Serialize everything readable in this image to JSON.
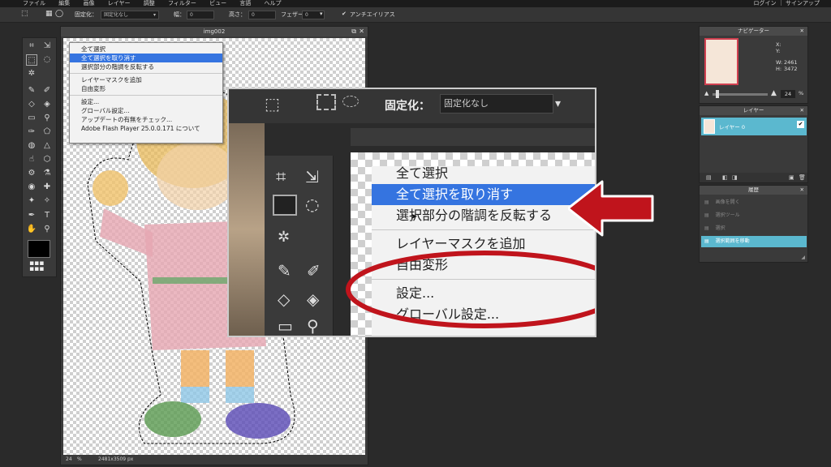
{
  "menubar": {
    "items": [
      "ファイル",
      "編集",
      "画像",
      "レイヤー",
      "調整",
      "フィルター",
      "ビュー",
      "言語",
      "ヘルプ"
    ],
    "right": "ログイン ｜ サインアップ"
  },
  "options": {
    "fixed_label": "固定化：",
    "fixed_value": "固定化なし",
    "width_label": "幅：",
    "width_value": "0",
    "height_label": "高さ：",
    "height_value": "0",
    "feather_label": "フェザー：",
    "feather_value": "0",
    "antialias_label": "アンチエイリアス"
  },
  "document": {
    "title": "img002",
    "zoom": "24",
    "zoom_unit": "%",
    "size": "2481x3509 px"
  },
  "context_menu": {
    "items": [
      {
        "label": "全て選択",
        "highlighted": false
      },
      {
        "label": "全て選択を取り消す",
        "highlighted": true
      },
      {
        "label": "選択部分の階調を反転する",
        "highlighted": false
      },
      {
        "label": "レイヤーマスクを追加",
        "highlighted": false
      },
      {
        "label": "自由変形",
        "highlighted": false
      },
      {
        "label": "設定...",
        "highlighted": false
      },
      {
        "label": "グローバル設定...",
        "highlighted": false
      },
      {
        "label": "アップデートの有無をチェック...",
        "highlighted": false
      },
      {
        "label": "Adobe Flash Player 25.0.0.171 について",
        "highlighted": false
      }
    ]
  },
  "zoom_inset": {
    "fixed_label": "固定化：",
    "fixed_value": "固定化なし",
    "menu_items": [
      "全て選択",
      "全て選択を取り消す",
      "選択部分の階調を反転する",
      "レイヤーマスクを追加",
      "自由変形",
      "設定...",
      "グローバル設定..."
    ]
  },
  "navigator": {
    "title": "ナビゲーター",
    "x_label": "X:",
    "y_label": "Y:",
    "w_label": "W:",
    "w_value": "2461",
    "h_label": "H:",
    "h_value": "3472",
    "zoom_value": "24",
    "zoom_unit": "%"
  },
  "layers": {
    "title": "レイヤー",
    "items": [
      {
        "name": "レイヤー 0",
        "visible": true
      }
    ]
  },
  "history": {
    "title": "履歴",
    "items": [
      {
        "label": "画像を開く",
        "active": false
      },
      {
        "label": "選択ツール",
        "active": false
      },
      {
        "label": "選択",
        "active": false
      },
      {
        "label": "選択範囲を移動",
        "active": true
      }
    ]
  },
  "colors": {
    "highlight": "#3574e0",
    "panel_active": "#5bb8cf",
    "annotation_red": "#c0141c"
  }
}
